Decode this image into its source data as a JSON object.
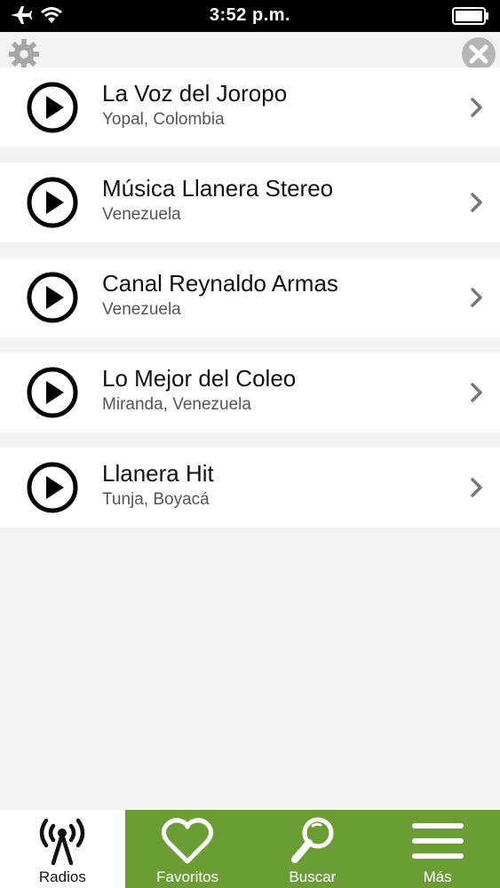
{
  "status_bar": {
    "time": "3:52 p.m."
  },
  "icons": {
    "airplane": "airplane-icon",
    "wifi": "wifi-icon",
    "battery": "battery-icon",
    "settings": "gear-icon",
    "close": "close-icon",
    "play": "play-icon",
    "chevron": "chevron-right-icon"
  },
  "stations": [
    {
      "name": "La Voz del Joropo",
      "location": "Yopal, Colombia"
    },
    {
      "name": "Música Llanera Stereo",
      "location": "Venezuela"
    },
    {
      "name": "Canal Reynaldo Armas",
      "location": "Venezuela"
    },
    {
      "name": "Lo Mejor del Coleo",
      "location": "Miranda, Venezuela"
    },
    {
      "name": "Llanera Hit",
      "location": "Tunja, Boyacá"
    }
  ],
  "tabs": [
    {
      "label": "Radios",
      "icon": "antenna-icon",
      "active": true
    },
    {
      "label": "Favoritos",
      "icon": "heart-icon",
      "active": false
    },
    {
      "label": "Buscar",
      "icon": "search-icon",
      "active": false
    },
    {
      "label": "Más",
      "icon": "menu-icon",
      "active": false
    }
  ],
  "colors": {
    "tab_bar": "#6a9e35",
    "status_bar": "#000000",
    "background": "#f2f2f2"
  }
}
